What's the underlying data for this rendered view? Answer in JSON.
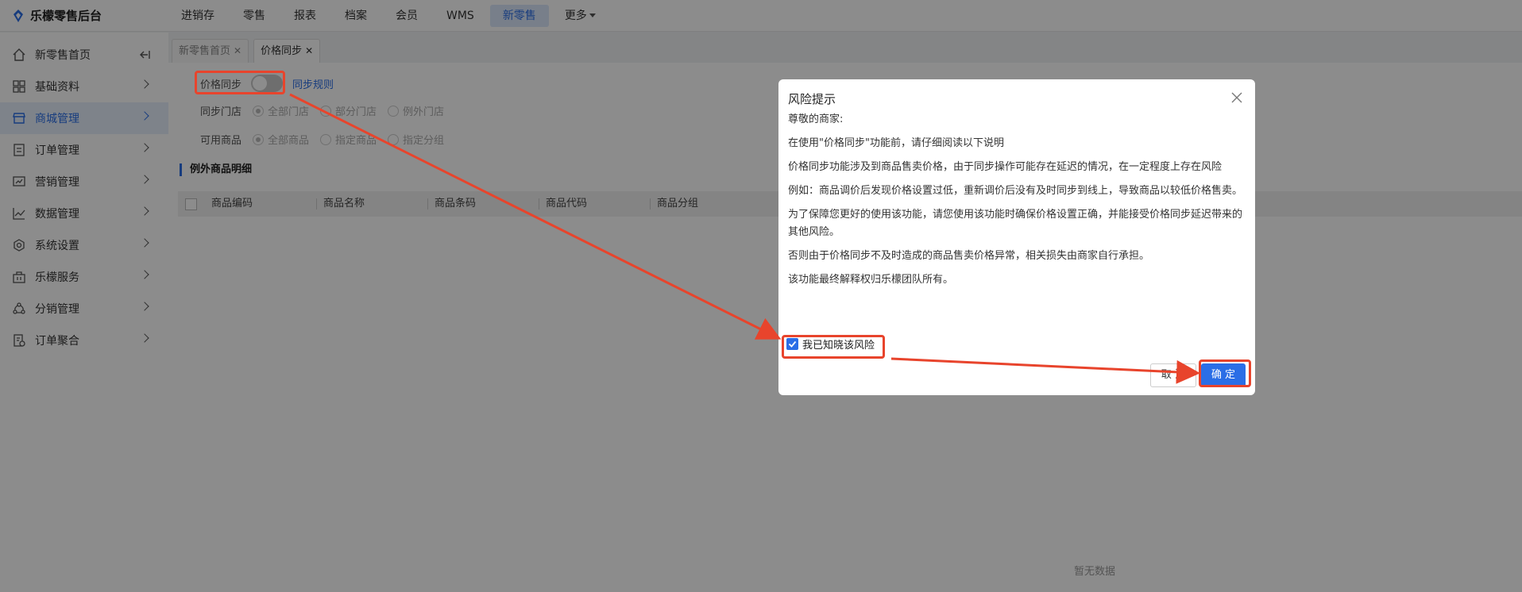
{
  "brand": {
    "name": "乐檬零售后台"
  },
  "topnav": {
    "items": [
      {
        "label": "进销存"
      },
      {
        "label": "零售"
      },
      {
        "label": "报表"
      },
      {
        "label": "档案"
      },
      {
        "label": "会员"
      },
      {
        "label": "WMS"
      },
      {
        "label": "新零售",
        "active": true
      },
      {
        "label": "更多"
      }
    ]
  },
  "sidebar": {
    "items": [
      {
        "label": "新零售首页",
        "icon": "home-icon"
      },
      {
        "label": "基础资料",
        "icon": "grid-icon"
      },
      {
        "label": "商城管理",
        "icon": "store-icon",
        "active": true
      },
      {
        "label": "订单管理",
        "icon": "order-icon"
      },
      {
        "label": "营销管理",
        "icon": "marketing-icon"
      },
      {
        "label": "数据管理",
        "icon": "chart-icon"
      },
      {
        "label": "系统设置",
        "icon": "settings-icon"
      },
      {
        "label": "乐檬服务",
        "icon": "service-icon"
      },
      {
        "label": "分销管理",
        "icon": "distribution-icon"
      },
      {
        "label": "订单聚合",
        "icon": "aggregate-icon"
      }
    ]
  },
  "tabs": [
    {
      "label": "新零售首页",
      "active": false
    },
    {
      "label": "价格同步",
      "active": true
    }
  ],
  "form": {
    "price_sync_label": "价格同步",
    "price_sync_on": false,
    "sync_rule_link": "同步规则",
    "sync_store_label": "同步门店",
    "sync_store_options": [
      "全部门店",
      "部分门店",
      "例外门店"
    ],
    "sync_store_selected": 0,
    "goods_label": "可用商品",
    "goods_options": [
      "全部商品",
      "指定商品",
      "指定分组"
    ],
    "goods_selected": 0
  },
  "section": {
    "title": "例外商品明细"
  },
  "table": {
    "columns": [
      "商品编码",
      "商品名称",
      "商品条码",
      "商品代码",
      "商品分组"
    ],
    "empty_text": "暂无数据"
  },
  "modal": {
    "title": "风险提示",
    "paragraphs": [
      "尊敬的商家:",
      "在使用\"价格同步\"功能前，请仔细阅读以下说明",
      "价格同步功能涉及到商品售卖价格，由于同步操作可能存在延迟的情况，在一定程度上存在风险",
      "例如：商品调价后发现价格设置过低，重新调价后没有及时同步到线上，导致商品以较低价格售卖。",
      "为了保障您更好的使用该功能，请您使用该功能时确保价格设置正确，并能接受价格同步延迟带来的其他风险。",
      "否则由于价格同步不及时造成的商品售卖价格异常，相关损失由商家自行承担。",
      "该功能最终解释权归乐檬团队所有。"
    ],
    "checkbox_label": "我已知晓该风险",
    "checkbox_checked": true,
    "cancel_label": "取 消",
    "ok_label": "确 定"
  },
  "colors": {
    "accent": "#2b6ee6",
    "highlight": "#e8442c"
  }
}
